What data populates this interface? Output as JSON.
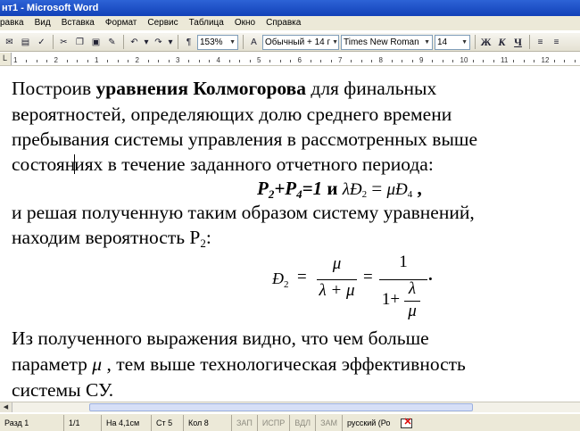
{
  "window": {
    "title": "нт1 - Microsoft Word"
  },
  "menu": [
    "равка",
    "Вид",
    "Вставка",
    "Формат",
    "Сервис",
    "Таблица",
    "Окно",
    "Справка"
  ],
  "toolbar": {
    "zoom": "153%",
    "style": "Обычный + 14 г",
    "font": "Times New Roman",
    "size": "14",
    "bold_label": "Ж",
    "italic_label": "К",
    "underline_label": "Ч",
    "para_mark": "¶"
  },
  "ruler": {
    "numbers": [
      "1",
      "2",
      "1",
      "2",
      "3",
      "4",
      "5",
      "6",
      "7",
      "8",
      "9",
      "10",
      "11",
      "12",
      "13"
    ]
  },
  "document": {
    "line1_pre": "Построив ",
    "line1_bold": "уравнения Колмогорова",
    "line1_post": " для финальных",
    "line2": "вероятностей, определяющих долю среднего времени",
    "line3": "пребывания  системы управления  в рассмотренных выше",
    "line4_a": "состоян",
    "line4_b": "иях  в течение заданного отчетного  периода:",
    "eq1": {
      "p2": "P",
      "p2s": "2",
      "plus": "+P",
      "p4s": "4",
      "eq": "=1",
      "and": " и  ",
      "lam": "λĐ",
      "lamsub": "2",
      "eqs": " = ",
      "mu": "μĐ",
      "musub": "4",
      "comma": " ,"
    },
    "line5": "и решая полученную таким образом систему уравнений,",
    "line6": "находим вероятность P",
    "line6_sub": "2",
    "line6_end": ":",
    "eq2": {
      "lhs": "Đ",
      "lhs_sub": "2",
      "eq": "=",
      "num1": "μ",
      "den1": "λ + μ",
      "eq2": "=",
      "num2": "1",
      "den2_a": "1+",
      "den2_num": "λ",
      "den2_den": "μ",
      "dot": "."
    },
    "line7": "Из полученного выражения видно, что чем больше",
    "line8_a": "параметр  ",
    "line8_mu": "μ",
    "line8_b": " , тем выше  технологическая  эффективность",
    "line9": "системы СУ."
  },
  "status": {
    "page": "Разд  1",
    "pages": "1/1",
    "pos": "На 4,1см",
    "line": "Ст  5",
    "col": "Кол  8",
    "rec": "ЗАП",
    "trk": "ИСПР",
    "ext": "ВДЛ",
    "ovr": "ЗАМ",
    "lang": "русский (Ро"
  }
}
